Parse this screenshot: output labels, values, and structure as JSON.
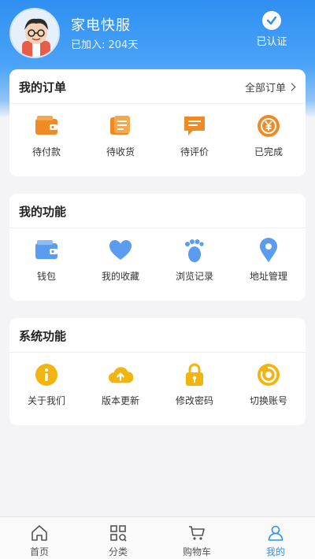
{
  "header": {
    "name": "家电快服",
    "days": "已加入: 204天",
    "verified": "已认证"
  },
  "orders": {
    "title": "我的订单",
    "more": "全部订单",
    "items": [
      {
        "label": "待付款",
        "icon": "wallet-icon"
      },
      {
        "label": "待收货",
        "icon": "package-icon"
      },
      {
        "label": "待评价",
        "icon": "comment-icon"
      },
      {
        "label": "已完成",
        "icon": "yen-done-icon"
      }
    ]
  },
  "functions": {
    "title": "我的功能",
    "items": [
      {
        "label": "钱包",
        "icon": "wallet-icon"
      },
      {
        "label": "我的收藏",
        "icon": "heart-icon"
      },
      {
        "label": "浏览记录",
        "icon": "footprint-icon"
      },
      {
        "label": "地址管理",
        "icon": "location-pin-icon"
      }
    ]
  },
  "system": {
    "title": "系统功能",
    "items": [
      {
        "label": "关于我们",
        "icon": "info-icon"
      },
      {
        "label": "版本更新",
        "icon": "cloud-upload-icon"
      },
      {
        "label": "修改密码",
        "icon": "lock-icon"
      },
      {
        "label": "切换账号",
        "icon": "switch-account-icon"
      }
    ]
  },
  "tabbar": {
    "tabs": [
      {
        "label": "首页",
        "icon": "home-icon"
      },
      {
        "label": "分类",
        "icon": "category-icon"
      },
      {
        "label": "购物车",
        "icon": "cart-icon"
      },
      {
        "label": "我的",
        "icon": "user-icon",
        "active": true
      }
    ]
  },
  "colors": {
    "primary": "#2f8ff2",
    "orange": "#f08a24",
    "blue_icon": "#5a9cf0",
    "yellow": "#f2b40f"
  }
}
